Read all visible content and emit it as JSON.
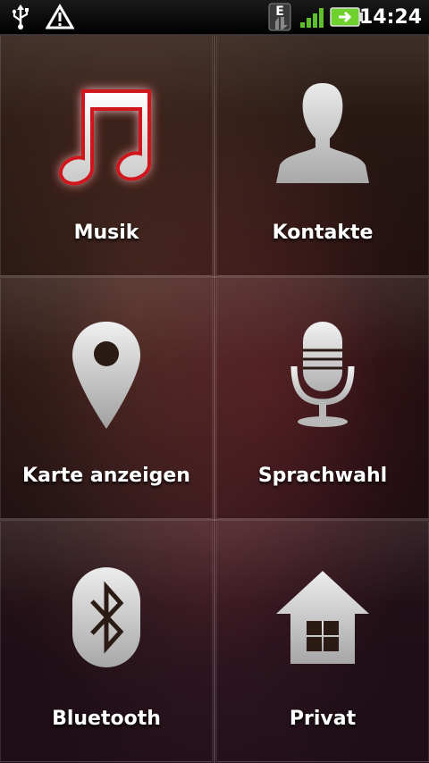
{
  "status_bar": {
    "usb_icon": "usb-icon",
    "warning_icon": "warning-triangle-icon",
    "network_type": "E",
    "signal_icon": "signal-strength-icon",
    "battery_icon": "battery-charging-icon",
    "time": "14:24"
  },
  "tiles": [
    {
      "label": "Musik",
      "icon": "music-note-icon"
    },
    {
      "label": "Kontakte",
      "icon": "person-icon"
    },
    {
      "label": "Karte anzeigen",
      "icon": "map-pin-icon"
    },
    {
      "label": "Sprachwahl",
      "icon": "microphone-icon"
    },
    {
      "label": "Bluetooth",
      "icon": "bluetooth-icon"
    },
    {
      "label": "Privat",
      "icon": "home-icon"
    }
  ],
  "colors": {
    "icon_fill": "#d8d8d8",
    "music_glow": "#c0141a",
    "label": "#ffffff"
  }
}
